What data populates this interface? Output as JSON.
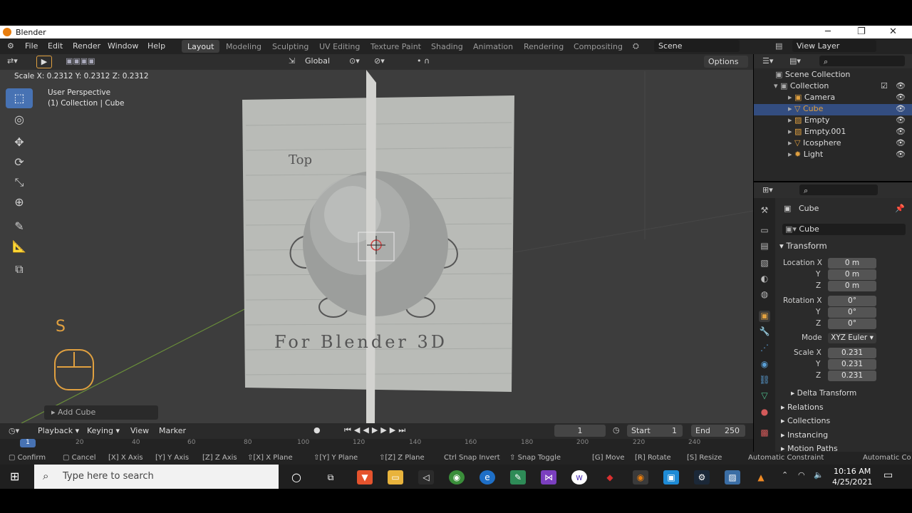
{
  "window": {
    "title": "Blender",
    "minimize": "─",
    "maximize": "❐",
    "close": "✕"
  },
  "menu": {
    "items": [
      "File",
      "Edit",
      "Render",
      "Window",
      "Help"
    ]
  },
  "workspaces": [
    "Layout",
    "Modeling",
    "Sculpting",
    "UV Editing",
    "Texture Paint",
    "Shading",
    "Animation",
    "Rendering",
    "Compositing"
  ],
  "scene": {
    "name": "Scene",
    "view_layer": "View Layer"
  },
  "viewport": {
    "transform_space": "Global",
    "options": "Options",
    "scale_readout": "Scale X: 0.2312  Y: 0.2312  Z: 0.2312",
    "perspective": "User Perspective",
    "collection_info": "(1) Collection | Cube",
    "key_hint": "S",
    "last_op": "Add Cube",
    "paper_text_top": "Top",
    "paper_text_bottom": "For Blender 3D"
  },
  "timeline": {
    "playback": "Playback",
    "keying": "Keying",
    "view": "View",
    "marker": "Marker",
    "current_frame": "1",
    "start_label": "Start",
    "start": "1",
    "end_label": "End",
    "end": "250",
    "ruler": [
      "1",
      "20",
      "40",
      "60",
      "80",
      "100",
      "120",
      "140",
      "160",
      "180",
      "200",
      "220",
      "240"
    ]
  },
  "statusbar": {
    "items": [
      "Confirm",
      "Cancel",
      "X Axis",
      "Y Axis",
      "Z Axis",
      "X Plane",
      "Y Plane",
      "Z Plane",
      "Snap Invert",
      "Snap Toggle",
      "Move",
      "Rotate",
      "Resize",
      "Automatic Constraint",
      "Automatic Co"
    ]
  },
  "outliner": {
    "root": "Scene Collection",
    "collection": "Collection",
    "objects": [
      {
        "name": "Camera",
        "selected": false,
        "color": "#e0a040"
      },
      {
        "name": "Cube",
        "selected": true,
        "color": "#e0a040"
      },
      {
        "name": "Empty",
        "selected": false,
        "color": "#e0a040"
      },
      {
        "name": "Empty.001",
        "selected": false,
        "color": "#e0a040"
      },
      {
        "name": "Icosphere",
        "selected": false,
        "color": "#e0a040"
      },
      {
        "name": "Light",
        "selected": false,
        "color": "#e0a040"
      }
    ]
  },
  "properties": {
    "object_name": "Cube",
    "data_name": "Cube",
    "transform_header": "Transform",
    "location_label": "Location X",
    "rotation_label": "Rotation X",
    "scale_label": "Scale X",
    "y_label": "Y",
    "z_label": "Z",
    "mode_label": "Mode",
    "mode_value": "XYZ Euler",
    "location": [
      "0 m",
      "0 m",
      "0 m"
    ],
    "rotation": [
      "0°",
      "0°",
      "0°"
    ],
    "scale": [
      "0.231",
      "0.231",
      "0.231"
    ],
    "sections": [
      "Delta Transform",
      "Relations",
      "Collections",
      "Instancing",
      "Motion Paths"
    ]
  },
  "taskbar": {
    "search_placeholder": "Type here to search",
    "time": "10:16 AM",
    "date": "4/25/2021"
  },
  "colors": {
    "accent": "#4772b3",
    "selected_row": "#334d80",
    "orange": "#e0a040"
  }
}
